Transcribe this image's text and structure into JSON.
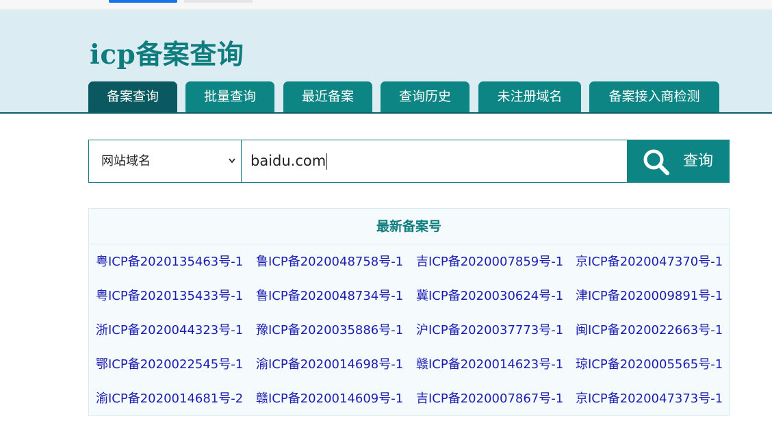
{
  "site": {
    "logo": "icp备案查询"
  },
  "nav": {
    "tabs": [
      {
        "label": "备案查询",
        "active": true
      },
      {
        "label": "批量查询",
        "active": false
      },
      {
        "label": "最近备案",
        "active": false
      },
      {
        "label": "查询历史",
        "active": false
      },
      {
        "label": "未注册域名",
        "active": false
      },
      {
        "label": "备案接入商检测",
        "active": false
      }
    ]
  },
  "search": {
    "type_selected": "网站域名",
    "query": "baidu.com",
    "button_label": "查询",
    "button_icon": "search-icon"
  },
  "latest": {
    "title": "最新备案号",
    "rows": [
      [
        "粤ICP备2020135463号-1",
        "鲁ICP备2020048758号-1",
        "吉ICP备2020007859号-1",
        "京ICP备2020047370号-1"
      ],
      [
        "粤ICP备2020135433号-1",
        "鲁ICP备2020048734号-1",
        "冀ICP备2020030624号-1",
        "津ICP备2020009891号-1"
      ],
      [
        "浙ICP备2020044323号-1",
        "豫ICP备2020035886号-1",
        "沪ICP备2020037773号-1",
        "闽ICP备2020022663号-1"
      ],
      [
        "鄂ICP备2020022545号-1",
        "渝ICP备2020014698号-1",
        "赣ICP备2020014623号-1",
        "琼ICP备2020005565号-1"
      ],
      [
        "渝ICP备2020014681号-2",
        "赣ICP备2020014609号-1",
        "吉ICP备2020007867号-1",
        "京ICP备2020047373号-1"
      ]
    ]
  },
  "colors": {
    "accent": "#0d8585",
    "accent_dark": "#0a5960",
    "header_bg": "#dcecf3",
    "link": "#1b1db0"
  }
}
